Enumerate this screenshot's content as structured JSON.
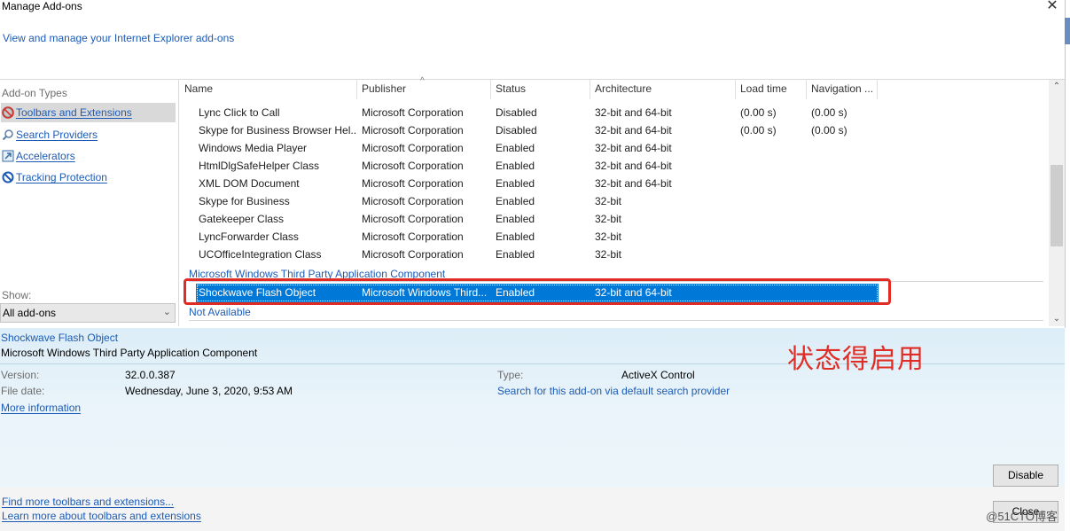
{
  "window": {
    "title": "Manage Add-ons",
    "subtitle": "View and manage your Internet Explorer add-ons",
    "close_glyph": "✕"
  },
  "sidebar": {
    "heading": "Add-on Types",
    "items": [
      {
        "label": "Toolbars and Extensions",
        "icon": "gear-block-icon",
        "active": true
      },
      {
        "label": "Search Providers",
        "icon": "search-icon",
        "active": false
      },
      {
        "label": "Accelerators",
        "icon": "accelerator-icon",
        "active": false
      },
      {
        "label": "Tracking Protection",
        "icon": "block-icon",
        "active": false
      }
    ],
    "show_label": "Show:",
    "show_value": "All add-ons"
  },
  "columns": [
    "Name",
    "Publisher",
    "Status",
    "Architecture",
    "Load time",
    "Navigation ..."
  ],
  "rows": [
    {
      "name": "Lync Click to Call",
      "publisher": "Microsoft Corporation",
      "status": "Disabled",
      "arch": "32-bit and 64-bit",
      "load": "(0.00 s)",
      "nav": "(0.00 s)"
    },
    {
      "name": "Skype for Business Browser Hel...",
      "publisher": "Microsoft Corporation",
      "status": "Disabled",
      "arch": "32-bit and 64-bit",
      "load": "(0.00 s)",
      "nav": "(0.00 s)"
    },
    {
      "name": "Windows Media Player",
      "publisher": "Microsoft Corporation",
      "status": "Enabled",
      "arch": "32-bit and 64-bit",
      "load": "",
      "nav": ""
    },
    {
      "name": "HtmlDlgSafeHelper Class",
      "publisher": "Microsoft Corporation",
      "status": "Enabled",
      "arch": "32-bit and 64-bit",
      "load": "",
      "nav": ""
    },
    {
      "name": "XML DOM Document",
      "publisher": "Microsoft Corporation",
      "status": "Enabled",
      "arch": "32-bit and 64-bit",
      "load": "",
      "nav": ""
    },
    {
      "name": "Skype for Business",
      "publisher": "Microsoft Corporation",
      "status": "Enabled",
      "arch": "32-bit",
      "load": "",
      "nav": ""
    },
    {
      "name": "Gatekeeper Class",
      "publisher": "Microsoft Corporation",
      "status": "Enabled",
      "arch": "32-bit",
      "load": "",
      "nav": ""
    },
    {
      "name": "LyncForwarder Class",
      "publisher": "Microsoft Corporation",
      "status": "Enabled",
      "arch": "32-bit",
      "load": "",
      "nav": ""
    },
    {
      "name": "UCOfficeIntegration Class",
      "publisher": "Microsoft Corporation",
      "status": "Enabled",
      "arch": "32-bit",
      "load": "",
      "nav": ""
    }
  ],
  "group_heading": "Microsoft Windows Third Party Application Component",
  "selected_row": {
    "name": "Shockwave Flash Object",
    "publisher": "Microsoft Windows Third...",
    "status": "Enabled",
    "arch": "32-bit and 64-bit"
  },
  "not_available": "Not Available",
  "details": {
    "name": "Shockwave Flash Object",
    "publisher": "Microsoft Windows Third Party Application Component",
    "version_label": "Version:",
    "version_value": "32.0.0.387",
    "file_date_label": "File date:",
    "file_date_value": "Wednesday, June 3, 2020, 9:53 AM",
    "more_info": "More information",
    "type_label": "Type:",
    "type_value": "ActiveX Control",
    "search_link": "Search for this add-on via default search provider",
    "annotation": "状态得启用",
    "disable_button": "Disable",
    "close_button": "Close",
    "find_more": "Find more toolbars and extensions...",
    "learn_more": "Learn more about toolbars and extensions",
    "watermark": "@51CTO博客"
  },
  "colors": {
    "link": "#1c5bb5",
    "selection": "#0078d7",
    "annotation_red": "#e12b25"
  }
}
